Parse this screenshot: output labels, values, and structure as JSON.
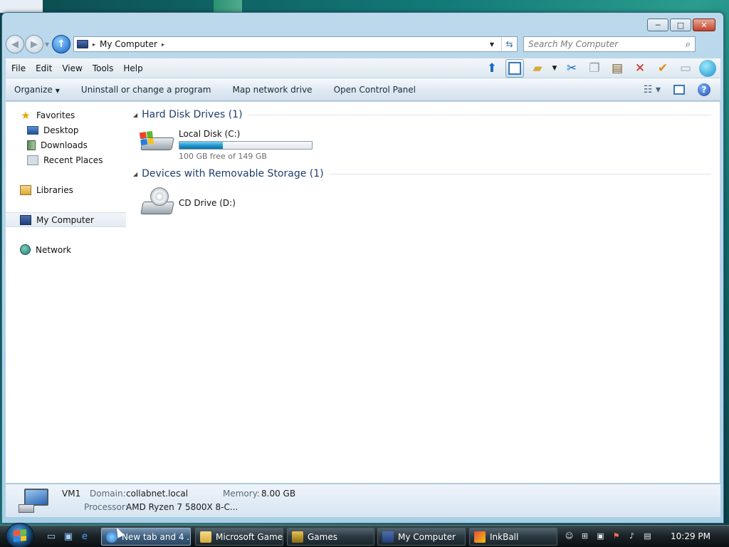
{
  "window": {
    "caption_buttons": {
      "minimize": "─",
      "maximize": "□",
      "close": "✕"
    }
  },
  "address_bar": {
    "location": "My Computer",
    "separator": "▸"
  },
  "search": {
    "placeholder": "Search My Computer"
  },
  "menu": [
    "File",
    "Edit",
    "View",
    "Tools",
    "Help"
  ],
  "command_bar": {
    "organize": "Organize",
    "commands": [
      "Uninstall or change a program",
      "Map network drive",
      "Open Control Panel"
    ]
  },
  "nav_pane": {
    "favorites": "Favorites",
    "favorites_items": [
      "Desktop",
      "Downloads",
      "Recent Places"
    ],
    "libraries": "Libraries",
    "computer": "My Computer",
    "network": "Network"
  },
  "content": {
    "group_hdd": "Hard Disk Drives (1)",
    "group_removable": "Devices with Removable Storage (1)",
    "local_disk": {
      "name": "Local Disk (C:)",
      "free_text": "100 GB free of 149 GB",
      "used_fraction": 0.33
    },
    "cd_drive": {
      "name": "CD Drive (D:)"
    }
  },
  "details": {
    "name": "VM1",
    "domain_label": "Domain:",
    "domain_value": "collabnet.local",
    "memory_label": "Memory:",
    "memory_value": "8.00 GB",
    "processor_label": "Processor:",
    "processor_value": "AMD Ryzen 7 5800X 8-C..."
  },
  "taskbar": {
    "tasks": [
      "New tab and 4 ...",
      "Microsoft Games",
      "Games",
      "My Computer",
      "InkBall"
    ],
    "clock": "10:29 PM"
  },
  "colors": {
    "accent": "#1e3d6b",
    "bar_fill": "#26a0d4",
    "taskbar": "#1c2428"
  }
}
